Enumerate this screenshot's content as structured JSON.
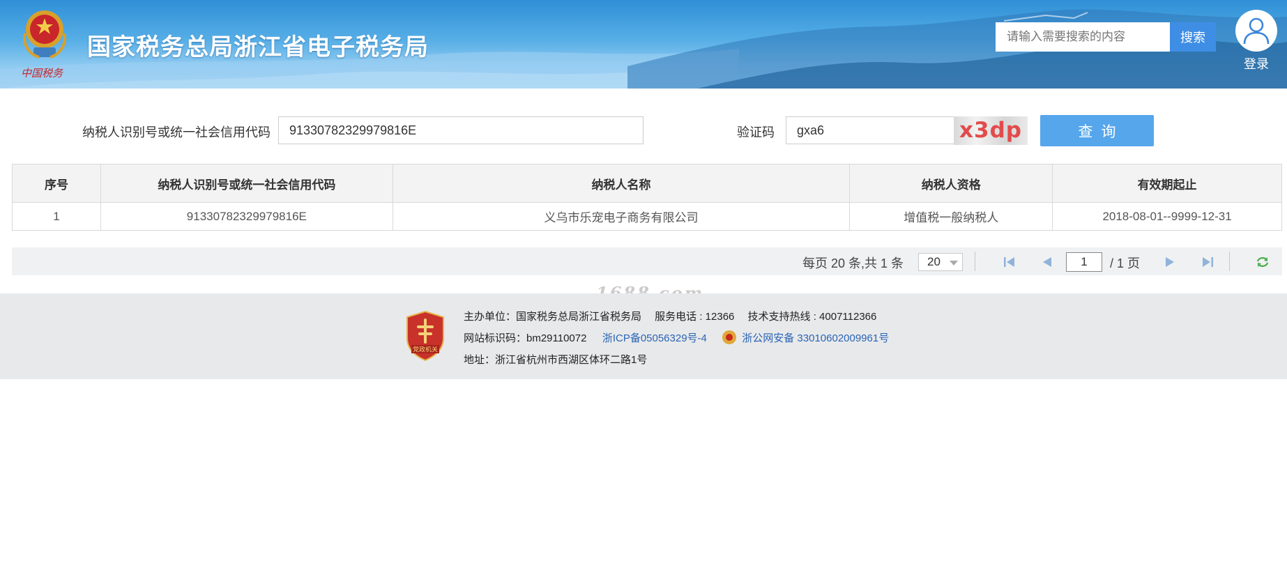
{
  "header": {
    "site_title": "国家税务总局浙江省电子税务局",
    "search_placeholder": "请输入需要搜索的内容",
    "search_button": "搜索",
    "login_label": "登录"
  },
  "query": {
    "taxpayer_id_label": "纳税人识别号或统一社会信用代码",
    "taxpayer_id_value": "91330782329979816E",
    "captcha_label": "验证码",
    "captcha_value": "gxa6",
    "captcha_image_text": "x3dp",
    "query_button": "查询"
  },
  "table": {
    "headers": [
      "序号",
      "纳税人识别号或统一社会信用代码",
      "纳税人名称",
      "纳税人资格",
      "有效期起止"
    ],
    "rows": [
      [
        "1",
        "91330782329979816E",
        "义乌市乐宠电子商务有限公司",
        "增值税一般纳税人",
        "2018-08-01--9999-12-31"
      ]
    ]
  },
  "pager": {
    "info": "每页 20 条,共 1 条",
    "page_size": "20",
    "current_page": "1",
    "total_pages": "/ 1 页"
  },
  "watermark": "1688.com",
  "footer": {
    "line1": "主办单位：国家税务总局浙江省税务局　 服务电话 : 12366　 技术支持热线 : 4007112366",
    "site_id": "网站标识码：bm29110072",
    "icp": "浙ICP备05056329号-4",
    "police_record": "浙公网安备 33010602009961号",
    "address": "地址：浙江省杭州市西湖区体环二路1号",
    "badge_text": "党政机关"
  },
  "colors": {
    "header_blue": "#3a95da",
    "search_button": "#3f8ee6",
    "query_button": "#56a6ec",
    "captcha_text": "#e24b4b",
    "footer_link": "#2a64b4"
  }
}
